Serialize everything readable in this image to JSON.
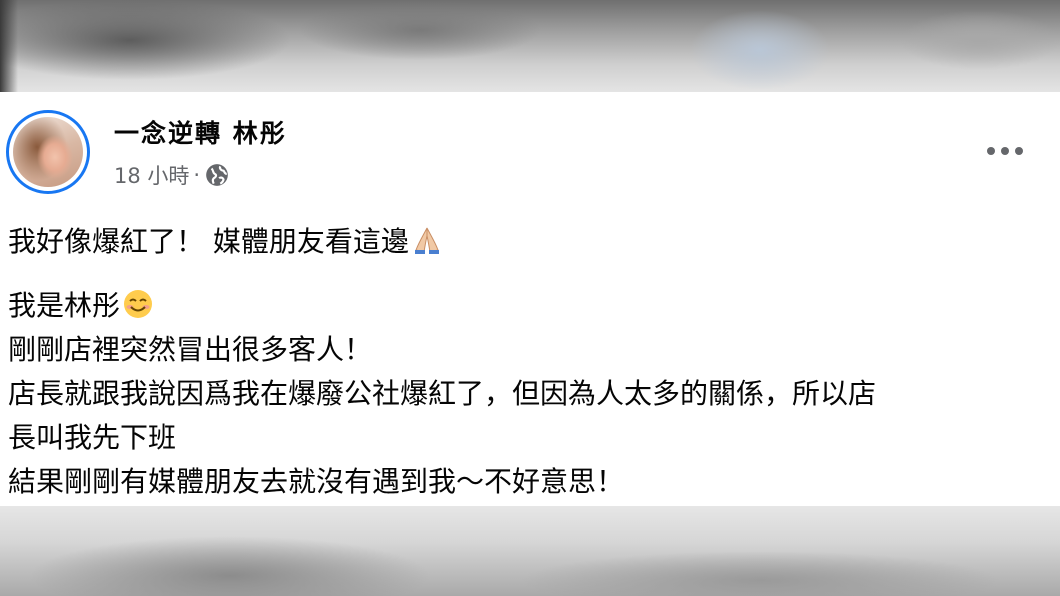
{
  "post": {
    "author": "一念逆轉 林彤",
    "time": "18 小時",
    "separator": "·",
    "privacy_icon": "globe-icon",
    "menu_icon": "more-options-icon",
    "lines": [
      "我好像爆紅了！  媒體朋友看這邊",
      "我是林彤",
      "剛剛店裡突然冒出很多客人！",
      "店長就跟我說因爲我在爆廢公社爆紅了，但因為人太多的關係，所以店",
      "長叫我先下班",
      "結果剛剛有媒體朋友去就沒有遇到我～不好意思！"
    ],
    "emojis": [
      "folded-hands-emoji",
      "smiling-face-emoji"
    ]
  },
  "colors": {
    "avatar_ring": "#1877f2",
    "meta_text": "#65676b",
    "body_text": "#050505"
  }
}
